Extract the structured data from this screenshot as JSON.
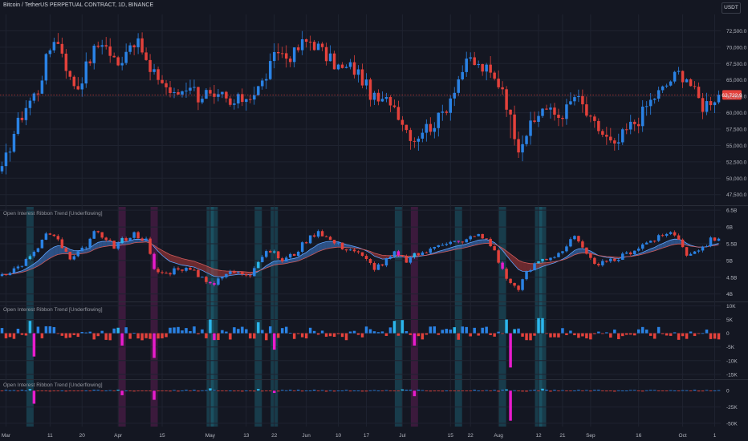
{
  "header": {
    "symbol_title": "Bitcoin / TetherUS PERPETUAL CONTRACT, 1D, BINANCE",
    "currency": "USDT"
  },
  "panes": {
    "oi_title": "Open Interest Ribbon Trend [Underflowing]",
    "delta_title": "Open Interest Ribbon Trend [Underflowing]",
    "delta2_title": "Open Interest Ribbon Trend [Underflowing]"
  },
  "colors": {
    "background": "#141722",
    "grid": "#1f2330",
    "up": "#2a82e4",
    "down": "#e3413b",
    "strong_up": "#2bb6ec",
    "strong_down": "#e81ccc",
    "ribbon_up": "#3f7fd6",
    "ribbon_down": "#b23a3a",
    "price_badge": "#e3413b",
    "axis_text": "#b2b5be"
  },
  "chart_data": [
    {
      "type": "candlestick",
      "name": "price",
      "ylim": [
        46000,
        75000
      ],
      "yticks": [
        "72,500.0",
        "70,000.0",
        "67,500.0",
        "65,000.0",
        "62,500.0",
        "60,000.0",
        "57,500.0",
        "55,000.0",
        "52,500.0",
        "50,000.0",
        "47,500.0"
      ],
      "ytick_values": [
        72500,
        70000,
        67500,
        65000,
        62500,
        60000,
        57500,
        55000,
        52500,
        50000,
        47500
      ],
      "last_price": "62,722.9",
      "last_price_value": 62722.9,
      "close_anchors": [
        [
          0,
          51000
        ],
        [
          3,
          57000
        ],
        [
          6,
          61000
        ],
        [
          9,
          63500
        ],
        [
          11,
          68000
        ],
        [
          13,
          71500
        ],
        [
          15,
          69500
        ],
        [
          17,
          65000
        ],
        [
          19,
          64000
        ],
        [
          21,
          67000
        ],
        [
          23,
          69500
        ],
        [
          25,
          71000
        ],
        [
          27,
          69000
        ],
        [
          29,
          67000
        ],
        [
          31,
          70000
        ],
        [
          33,
          71000
        ],
        [
          35,
          69500
        ],
        [
          37,
          66000
        ],
        [
          39,
          65500
        ],
        [
          41,
          64000
        ],
        [
          43,
          62500
        ],
        [
          45,
          63500
        ],
        [
          47,
          64500
        ],
        [
          49,
          62500
        ],
        [
          51,
          63000
        ],
        [
          53,
          61500
        ],
        [
          55,
          62500
        ],
        [
          57,
          61000
        ],
        [
          59,
          61800
        ],
        [
          61,
          62500
        ],
        [
          63,
          63000
        ],
        [
          65,
          64500
        ],
        [
          67,
          67000
        ],
        [
          69,
          69500
        ],
        [
          71,
          68500
        ],
        [
          73,
          69000
        ],
        [
          75,
          70500
        ],
        [
          77,
          71000
        ],
        [
          79,
          70000
        ],
        [
          81,
          68500
        ],
        [
          83,
          67500
        ],
        [
          85,
          66500
        ],
        [
          87,
          67000
        ],
        [
          89,
          66000
        ],
        [
          91,
          64000
        ],
        [
          93,
          62000
        ],
        [
          95,
          61500
        ],
        [
          97,
          62000
        ],
        [
          99,
          60000
        ],
        [
          101,
          57500
        ],
        [
          103,
          56000
        ],
        [
          105,
          57500
        ],
        [
          107,
          58000
        ],
        [
          109,
          59000
        ],
        [
          111,
          61000
        ],
        [
          113,
          64000
        ],
        [
          115,
          66500
        ],
        [
          117,
          68000
        ],
        [
          119,
          67000
        ],
        [
          121,
          66500
        ],
        [
          123,
          65000
        ],
        [
          125,
          64000
        ],
        [
          127,
          59000
        ],
        [
          129,
          55000
        ],
        [
          131,
          57000
        ],
        [
          133,
          58500
        ],
        [
          135,
          61000
        ],
        [
          137,
          60000
        ],
        [
          139,
          59500
        ],
        [
          141,
          60500
        ],
        [
          143,
          62500
        ],
        [
          145,
          61000
        ],
        [
          147,
          58500
        ],
        [
          149,
          57500
        ],
        [
          151,
          56000
        ],
        [
          153,
          54500
        ],
        [
          155,
          56500
        ],
        [
          157,
          58000
        ],
        [
          159,
          59000
        ],
        [
          161,
          61000
        ],
        [
          163,
          62500
        ],
        [
          165,
          63500
        ],
        [
          167,
          65000
        ],
        [
          169,
          66000
        ],
        [
          171,
          65500
        ],
        [
          173,
          63000
        ],
        [
          175,
          61000
        ],
        [
          177,
          62000
        ],
        [
          179,
          62722.9
        ]
      ]
    },
    {
      "type": "candlestick-ribbon",
      "name": "open-interest",
      "ylim": [
        3.8,
        6.6
      ],
      "yticks": [
        "6.5B",
        "6B",
        "5.5B",
        "5B",
        "4.5B",
        "4B"
      ],
      "ytick_values": [
        6.5,
        6.0,
        5.5,
        5.0,
        4.5,
        4.0
      ],
      "close_anchors": [
        [
          0,
          4.6
        ],
        [
          4,
          4.8
        ],
        [
          8,
          5.2
        ],
        [
          11,
          5.8
        ],
        [
          14,
          5.6
        ],
        [
          17,
          5.0
        ],
        [
          20,
          5.3
        ],
        [
          23,
          5.8
        ],
        [
          26,
          5.7
        ],
        [
          28,
          5.4
        ],
        [
          30,
          5.6
        ],
        [
          33,
          5.8
        ],
        [
          36,
          5.6
        ],
        [
          38,
          4.7
        ],
        [
          41,
          4.6
        ],
        [
          44,
          4.8
        ],
        [
          47,
          4.7
        ],
        [
          50,
          4.5
        ],
        [
          53,
          4.3
        ],
        [
          56,
          4.6
        ],
        [
          59,
          4.7
        ],
        [
          62,
          4.6
        ],
        [
          64,
          5.0
        ],
        [
          67,
          5.3
        ],
        [
          70,
          5.0
        ],
        [
          73,
          5.2
        ],
        [
          76,
          5.6
        ],
        [
          79,
          5.9
        ],
        [
          82,
          5.6
        ],
        [
          85,
          5.4
        ],
        [
          88,
          5.3
        ],
        [
          90,
          5.1
        ],
        [
          93,
          4.8
        ],
        [
          95,
          4.9
        ],
        [
          98,
          5.2
        ],
        [
          101,
          5.0
        ],
        [
          104,
          5.2
        ],
        [
          107,
          5.3
        ],
        [
          109,
          5.5
        ],
        [
          112,
          5.6
        ],
        [
          115,
          5.5
        ],
        [
          118,
          5.8
        ],
        [
          121,
          5.6
        ],
        [
          123,
          5.3
        ],
        [
          125,
          4.7
        ],
        [
          127,
          4.3
        ],
        [
          129,
          4.2
        ],
        [
          131,
          4.6
        ],
        [
          134,
          5.0
        ],
        [
          137,
          5.1
        ],
        [
          140,
          5.3
        ],
        [
          143,
          5.7
        ],
        [
          145,
          5.3
        ],
        [
          147,
          5.0
        ],
        [
          150,
          4.9
        ],
        [
          153,
          5.0
        ],
        [
          156,
          5.2
        ],
        [
          159,
          5.4
        ],
        [
          162,
          5.6
        ],
        [
          165,
          5.7
        ],
        [
          167,
          5.9
        ],
        [
          169,
          5.6
        ],
        [
          171,
          5.2
        ],
        [
          173,
          5.3
        ],
        [
          175,
          5.4
        ],
        [
          177,
          5.6
        ],
        [
          179,
          5.7
        ]
      ]
    },
    {
      "type": "bar",
      "name": "oi-delta",
      "ylim": [
        -16500,
        11000
      ],
      "yticks": [
        "10K",
        "5K",
        "0",
        "-5K",
        "-10K",
        "-15K"
      ],
      "ytick_values": [
        10000,
        5000,
        0,
        -5000,
        -10000,
        -15000
      ],
      "strong_bars": [
        [
          7,
          4500
        ],
        [
          8,
          -8500
        ],
        [
          29,
          2000
        ],
        [
          30,
          -4500
        ],
        [
          38,
          -9000
        ],
        [
          52,
          5000
        ],
        [
          53,
          -2500
        ],
        [
          64,
          4000
        ],
        [
          68,
          -6000
        ],
        [
          98,
          4500
        ],
        [
          100,
          4800
        ],
        [
          103,
          -4500
        ],
        [
          113,
          2200
        ],
        [
          126,
          5000
        ],
        [
          128,
          1500
        ],
        [
          127,
          -12500
        ],
        [
          134,
          5500
        ],
        [
          135,
          5500
        ]
      ]
    },
    {
      "type": "bar",
      "name": "oi-delta-2",
      "ylim": [
        -55000,
        15000
      ],
      "yticks": [
        "0",
        "-25K",
        "-50K"
      ],
      "ytick_values": [
        0,
        -25000,
        -50000
      ],
      "strong_bars": [
        [
          7,
          2500
        ],
        [
          8,
          -20000
        ],
        [
          29,
          1500
        ],
        [
          30,
          -7000
        ],
        [
          38,
          -14000
        ],
        [
          52,
          3500
        ],
        [
          64,
          2500
        ],
        [
          68,
          -3500
        ],
        [
          100,
          2000
        ],
        [
          103,
          -8500
        ],
        [
          126,
          2000
        ],
        [
          127,
          -46000
        ],
        [
          135,
          3000
        ]
      ]
    },
    {
      "type": "highlight-bands",
      "name": "signal-columns",
      "bands": [
        {
          "index": 7,
          "kind": "up"
        },
        {
          "index": 30,
          "kind": "down"
        },
        {
          "index": 38,
          "kind": "down"
        },
        {
          "index": 52,
          "kind": "up"
        },
        {
          "index": 53,
          "kind": "up"
        },
        {
          "index": 64,
          "kind": "up"
        },
        {
          "index": 68,
          "kind": "up"
        },
        {
          "index": 99,
          "kind": "up"
        },
        {
          "index": 103,
          "kind": "down"
        },
        {
          "index": 114,
          "kind": "up"
        },
        {
          "index": 125,
          "kind": "up"
        },
        {
          "index": 134,
          "kind": "up"
        },
        {
          "index": 135,
          "kind": "up"
        }
      ],
      "signals_per_band": 1
    },
    {
      "type": "axis",
      "name": "time-axis",
      "bars": 180,
      "xticks": [
        {
          "label": "Mar",
          "index": 1
        },
        {
          "label": "11",
          "index": 12
        },
        {
          "label": "20",
          "index": 20
        },
        {
          "label": "Apr",
          "index": 29
        },
        {
          "label": "15",
          "index": 40
        },
        {
          "label": "May",
          "index": 52
        },
        {
          "label": "13",
          "index": 61
        },
        {
          "label": "22",
          "index": 68
        },
        {
          "label": "Jun",
          "index": 76
        },
        {
          "label": "10",
          "index": 84
        },
        {
          "label": "17",
          "index": 91
        },
        {
          "label": "Jul",
          "index": 100
        },
        {
          "label": "15",
          "index": 112
        },
        {
          "label": "22",
          "index": 117
        },
        {
          "label": "Aug",
          "index": 124
        },
        {
          "label": "12",
          "index": 134
        },
        {
          "label": "21",
          "index": 140
        },
        {
          "label": "Sep",
          "index": 147
        },
        {
          "label": "16",
          "index": 159
        },
        {
          "label": "Oct",
          "index": 170
        },
        {
          "label": "1",
          "index": 178
        }
      ]
    }
  ]
}
